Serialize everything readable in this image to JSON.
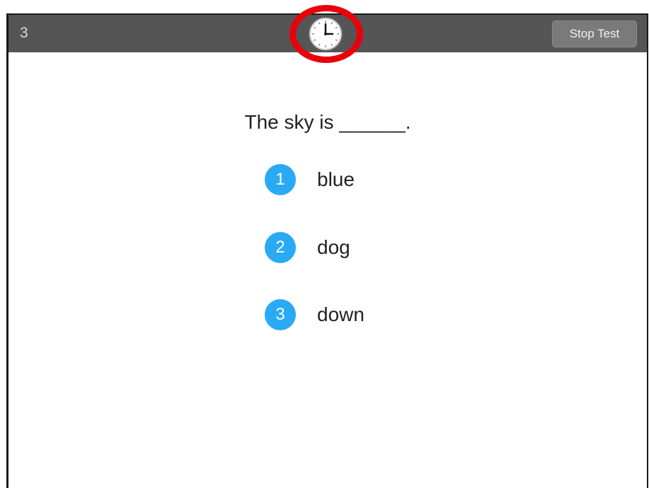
{
  "header": {
    "question_number": "3",
    "stop_label": "Stop Test",
    "timer_icon": "clock-icon"
  },
  "question": {
    "text": "The sky is ______."
  },
  "choices": [
    {
      "number": "1",
      "label": "blue"
    },
    {
      "number": "2",
      "label": "dog"
    },
    {
      "number": "3",
      "label": "down"
    }
  ],
  "colors": {
    "header_bg": "#555555",
    "badge": "#2aa9f5",
    "highlight": "#e8000b"
  }
}
